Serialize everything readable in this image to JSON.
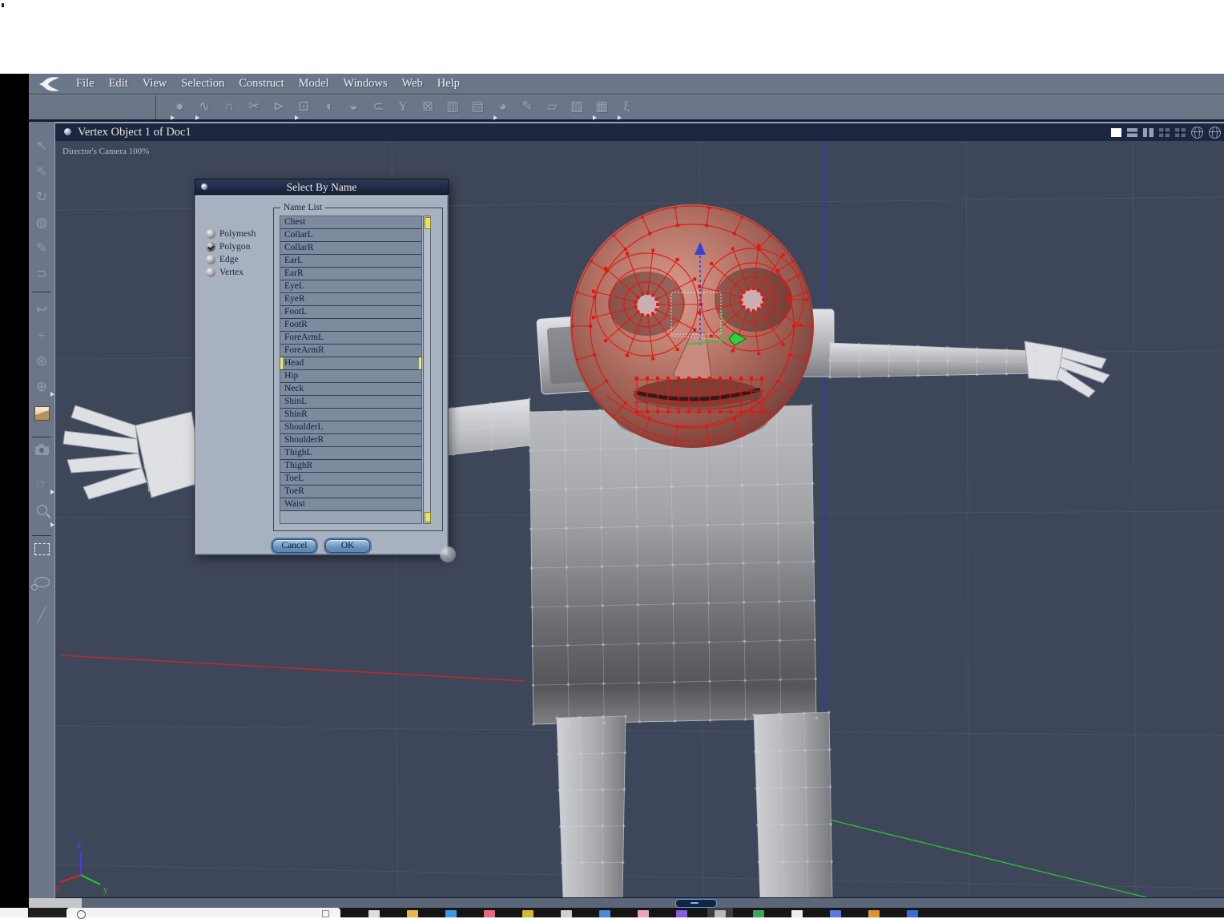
{
  "app": {
    "menu": [
      "File",
      "Edit",
      "View",
      "Selection",
      "Construct",
      "Model",
      "Windows",
      "Web",
      "Help"
    ],
    "toolbar_icons": [
      {
        "name": "sphere-tool",
        "flyout": true
      },
      {
        "name": "polyline-vertex-tool",
        "flyout": true
      },
      {
        "name": "magnet-tool",
        "flyout": false
      },
      {
        "name": "scissors-tool",
        "flyout": false
      },
      {
        "name": "weld-tool",
        "flyout": false
      },
      {
        "name": "transform-box-tool",
        "flyout": true
      },
      {
        "name": "dome-tool",
        "flyout": false
      },
      {
        "name": "lathe-tool",
        "flyout": false
      },
      {
        "name": "extrude-tool",
        "flyout": false
      },
      {
        "name": "goblet-tool",
        "flyout": false
      },
      {
        "name": "delete-region-tool",
        "flyout": false
      },
      {
        "name": "block-tool",
        "flyout": false
      },
      {
        "name": "wrap-tool",
        "flyout": false
      },
      {
        "name": "dome-cut-tool",
        "flyout": true
      },
      {
        "name": "pen-tool",
        "flyout": false
      },
      {
        "name": "bend-tool",
        "flyout": false
      },
      {
        "name": "fold-tool",
        "flyout": false
      },
      {
        "name": "mesh-edit-tool",
        "flyout": true
      },
      {
        "name": "bone-tool",
        "flyout": true
      }
    ],
    "left_tools": [
      {
        "name": "select-arrow-tool"
      },
      {
        "name": "dart-select-tool"
      },
      {
        "name": "rotate-view-tool"
      },
      {
        "name": "banked-sphere-tool"
      },
      {
        "name": "knife-tool"
      },
      {
        "name": "clamp-tool"
      },
      {
        "name": "divider"
      },
      {
        "name": "hook-tool"
      },
      {
        "name": "move-gizmo-tool"
      },
      {
        "name": "rotate-gizmo-tool"
      },
      {
        "name": "trackball-tool",
        "flyout": true
      },
      {
        "name": "view-cube-tool"
      },
      {
        "name": "divider"
      },
      {
        "name": "camera-tool"
      },
      {
        "name": "pan-hand-tool",
        "flyout": true
      },
      {
        "name": "zoom-tool",
        "flyout": true
      },
      {
        "name": "divider"
      },
      {
        "name": "marquee-select-tool",
        "active": true
      },
      {
        "name": "lasso-select-tool"
      },
      {
        "name": "brush-select-tool"
      }
    ]
  },
  "viewport": {
    "title": "Vertex Object 1 of Doc1",
    "camera_label": "Director's Camera 100%",
    "layout_icons": [
      "layout-single",
      "layout-split-horizontal",
      "layout-split-cross",
      "layout-split-quad",
      "layout-split-mixed"
    ],
    "globe_icons": [
      "wire-globe-a",
      "wire-globe-b"
    ],
    "axis_labels": {
      "x": "x",
      "y": "y",
      "z": "z"
    }
  },
  "dialog": {
    "title": "Select By Name",
    "group_label": "Name List",
    "radios": [
      {
        "label": "Polymesh",
        "selected": false
      },
      {
        "label": "Polygon",
        "selected": true
      },
      {
        "label": "Edge",
        "selected": false
      },
      {
        "label": "Vertex",
        "selected": false
      }
    ],
    "items": [
      "Chest",
      "CollarL",
      "CollarR",
      "EarL",
      "EarR",
      "EyeL",
      "EyeR",
      "FootL",
      "FootR",
      "ForeArmL",
      "ForeArmR",
      "Head",
      "Hip",
      "Neck",
      "ShinL",
      "ShinR",
      "ShoulderL",
      "ShoulderR",
      "ThighL",
      "ThighR",
      "ToeL",
      "ToeR",
      "Waist"
    ],
    "selected_item": "Head",
    "buttons": {
      "cancel": "Cancel",
      "ok": "OK"
    }
  },
  "taskbar": {
    "icons": [
      {
        "name": "chart-bars",
        "color": "#dddddd"
      },
      {
        "name": "folder",
        "color": "#e8b54a"
      },
      {
        "name": "window-blue",
        "color": "#3d9ae8"
      },
      {
        "name": "mail-red",
        "color": "#e86a7a"
      },
      {
        "name": "pen-yellow",
        "color": "#d8b830"
      },
      {
        "name": "pin-gray",
        "color": "#cfcfcf"
      },
      {
        "name": "window-blue2",
        "color": "#4a88d8"
      },
      {
        "name": "circle-pink",
        "color": "#e8a8bc"
      },
      {
        "name": "app-purple",
        "color": "#8a5ae0"
      },
      {
        "name": "sphere-gray",
        "color": "#b8b8b8",
        "highlight": true
      },
      {
        "name": "app-green",
        "color": "#3aa858"
      },
      {
        "name": "diamond-white",
        "color": "#eeeeee"
      },
      {
        "name": "flag-blue",
        "color": "#5a7ae0"
      },
      {
        "name": "app-orange",
        "color": "#d89830"
      },
      {
        "name": "circle-blue",
        "color": "#3a6ae0"
      }
    ]
  },
  "colors": {
    "selection_red": "#e01810",
    "axis_blue": "#2d35d8",
    "axis_green": "#25c535",
    "axis_red": "#d42420",
    "highlight_yellow": "#f2e75e",
    "viewport_bg": "#3e4659",
    "chrome": "#6b7689",
    "titlebar": "#1b2740",
    "panel": "#a7b1c0"
  }
}
